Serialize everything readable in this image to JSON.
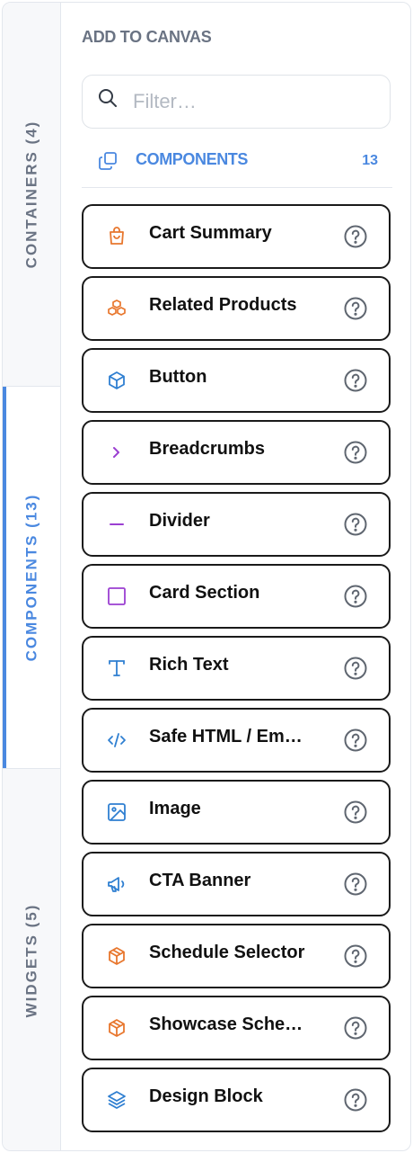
{
  "rail": {
    "tabs": [
      {
        "label": "CONTAINERS (4)",
        "active": false
      },
      {
        "label": "COMPONENTS (13)",
        "active": true
      },
      {
        "label": "WIDGETS (5)",
        "active": false
      }
    ]
  },
  "panel": {
    "heading": "ADD TO CANVAS",
    "search": {
      "placeholder": "Filter…",
      "value": ""
    },
    "section": {
      "title": "COMPONENTS",
      "count": "13",
      "icon": "copy-icon"
    }
  },
  "colors": {
    "accent": "#4a88e0",
    "orange": "#e8772e",
    "purple": "#9b3fd1",
    "blue": "#2f7fd1",
    "help": "#5f6670"
  },
  "items": [
    {
      "label": "Cart Summary",
      "icon": "shopping-bag-icon"
    },
    {
      "label": "Related Products",
      "icon": "boxes-icon"
    },
    {
      "label": "Button",
      "icon": "cube-icon"
    },
    {
      "label": "Breadcrumbs",
      "icon": "chevron-right-icon"
    },
    {
      "label": "Divider",
      "icon": "minus-icon"
    },
    {
      "label": "Card Section",
      "icon": "square-icon"
    },
    {
      "label": "Rich Text",
      "icon": "type-icon"
    },
    {
      "label": "Safe HTML / Em…",
      "icon": "code-icon"
    },
    {
      "label": "Image",
      "icon": "image-icon"
    },
    {
      "label": "CTA Banner",
      "icon": "megaphone-icon"
    },
    {
      "label": "Schedule Selector",
      "icon": "package-icon"
    },
    {
      "label": "Showcase Sche…",
      "icon": "package-icon"
    },
    {
      "label": "Design Block",
      "icon": "layers-icon"
    }
  ]
}
